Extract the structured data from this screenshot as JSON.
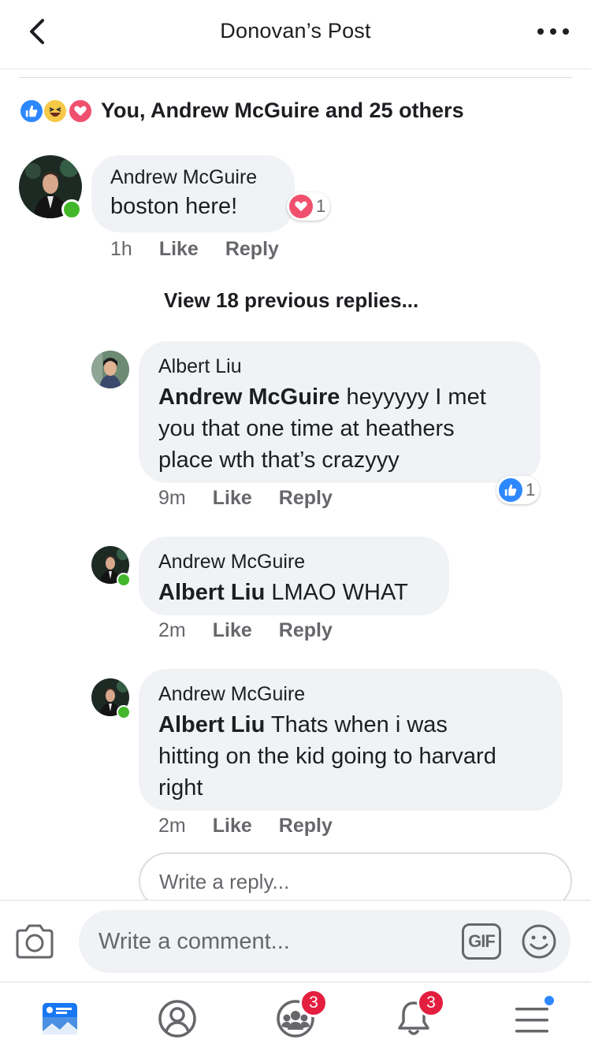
{
  "header": {
    "title": "Donovan’s Post"
  },
  "reactions": {
    "summary": "You, Andrew McGuire and 25 others"
  },
  "comment": {
    "author": "Andrew McGuire",
    "text": "boston here!",
    "time": "1h",
    "like": "Like",
    "reply": "Reply",
    "reaction_count": "1"
  },
  "view_previous": "View 18 previous replies...",
  "replies": [
    {
      "author": "Albert Liu",
      "mention": "Andrew McGuire",
      "text_line1": " heyyyyy I met",
      "text_line2": "you that one time at heathers",
      "text_line3": "place wth that’s crazyyy",
      "time": "9m",
      "like": "Like",
      "reply": "Reply",
      "reaction_count": "1"
    },
    {
      "author": "Andrew McGuire",
      "mention": "Albert Liu",
      "text_line1": " LMAO WHAT",
      "time": "2m",
      "like": "Like",
      "reply": "Reply"
    },
    {
      "author": "Andrew McGuire",
      "mention": "Albert Liu",
      "text_line1": " Thats when i was",
      "text_line2": "hitting on the kid going to harvard",
      "text_line3": "right",
      "time": "2m",
      "like": "Like",
      "reply": "Reply"
    }
  ],
  "reply_input": {
    "placeholder": "Write a reply..."
  },
  "composer": {
    "placeholder": "Write a comment...",
    "gif_label": "GIF"
  },
  "tabbar": {
    "groups_badge": "3",
    "notifications_badge": "3"
  },
  "colors": {
    "accent": "#2d88ff",
    "badge": "#e41e3f",
    "online": "#42b72a",
    "love": "#f0506e",
    "bubble": "#f0f2f5"
  },
  "icons": [
    "back-icon",
    "more-icon",
    "like-reaction-icon",
    "haha-reaction-icon",
    "love-reaction-icon",
    "camera-icon",
    "emoji-icon",
    "news-feed-icon",
    "profile-icon",
    "groups-icon",
    "bell-icon",
    "menu-icon"
  ]
}
